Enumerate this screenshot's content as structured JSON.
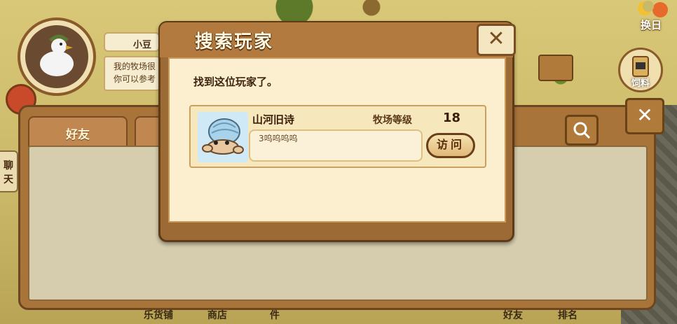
{
  "player": {
    "name": "小豆",
    "info_line1": "我的牧场很",
    "info_line2": "你可以参考"
  },
  "panel": {
    "tabs": [
      {
        "label": "好友"
      },
      {
        "label": ""
      }
    ],
    "side_chat_label": "聊天",
    "bottom_labels": [
      "乐货铺",
      "商店",
      "件",
      "好友",
      "排名"
    ]
  },
  "topright": {
    "swap_day_label": "换日",
    "feed_label": "饲料"
  },
  "dialog": {
    "title": "搜索玩家",
    "message": "找到这位玩家了。",
    "result": {
      "name": "山河旧诗",
      "level_label": "牧场等级",
      "level_value": "18",
      "signature": "3呜呜呜呜",
      "visit_label": "访问"
    }
  },
  "icons": {
    "close": "close-icon",
    "search": "search-icon",
    "avatar": "goose-avatar",
    "player_avatar": "hermit-crab-avatar"
  },
  "colors": {
    "wood": "#9c6a34",
    "paper": "#fbefcf",
    "text": "#3e2410"
  }
}
